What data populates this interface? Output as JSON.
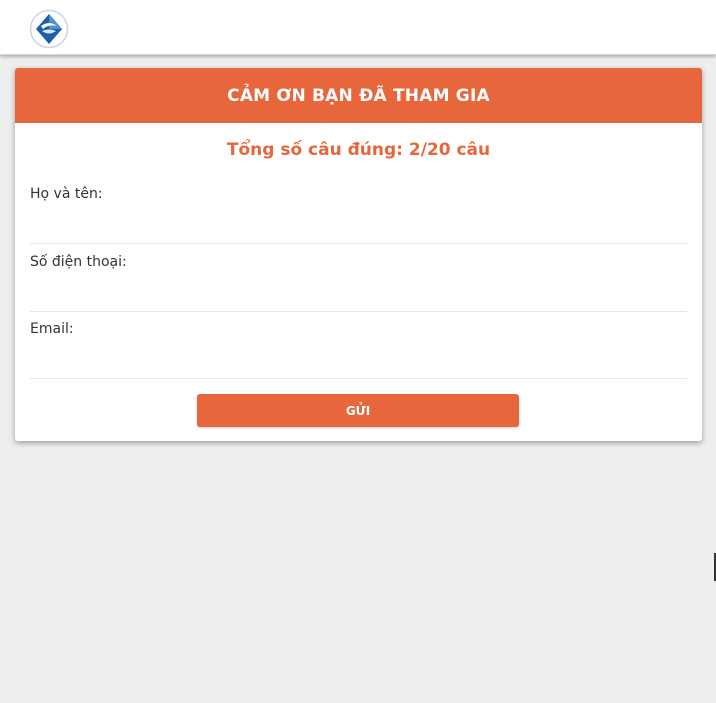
{
  "header": {
    "title": "CẢM ƠN BẠN ĐÃ THAM GIA"
  },
  "score": {
    "text": "Tổng số câu đúng: 2/20 câu"
  },
  "form": {
    "fields": [
      {
        "label": "Họ và tên:",
        "value": "",
        "placeholder": ""
      },
      {
        "label": "Số điện thoại:",
        "value": "",
        "placeholder": ""
      },
      {
        "label": "Email:",
        "value": "",
        "placeholder": ""
      }
    ],
    "submit_label": "GỬI"
  },
  "colors": {
    "accent": "#e8663b",
    "background": "#eeeeee",
    "card": "#ffffff",
    "logo_blue": "#1a5fa8"
  }
}
